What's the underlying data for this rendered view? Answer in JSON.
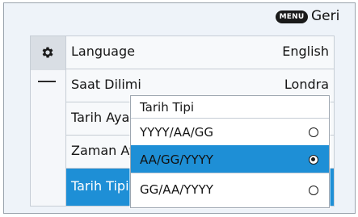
{
  "header": {
    "menu_key": "MENU",
    "back_label": "Geri"
  },
  "sidebar": {
    "tabs": [
      {
        "icon": "gear-icon",
        "active": true
      },
      {
        "icon": "dash-icon",
        "active": false
      }
    ]
  },
  "menu": {
    "items": [
      {
        "label": "Language",
        "value": "English"
      },
      {
        "label": "Saat Dilimi",
        "value": "Londra"
      },
      {
        "label": "Tarih Ayar",
        "value": ""
      },
      {
        "label": "Zaman Ay",
        "value": ""
      },
      {
        "label": "Tarih Tipi",
        "value": "",
        "selected": true
      }
    ]
  },
  "popup": {
    "title": "Tarih Tipi",
    "options": [
      {
        "label": "YYYY/AA/GG",
        "selected": false
      },
      {
        "label": "AA/GG/YYYY",
        "selected": true
      },
      {
        "label": "GG/AA/YYYY",
        "selected": false
      }
    ]
  },
  "colors": {
    "accent": "#1e8fd6",
    "background": "#eef3f9"
  }
}
